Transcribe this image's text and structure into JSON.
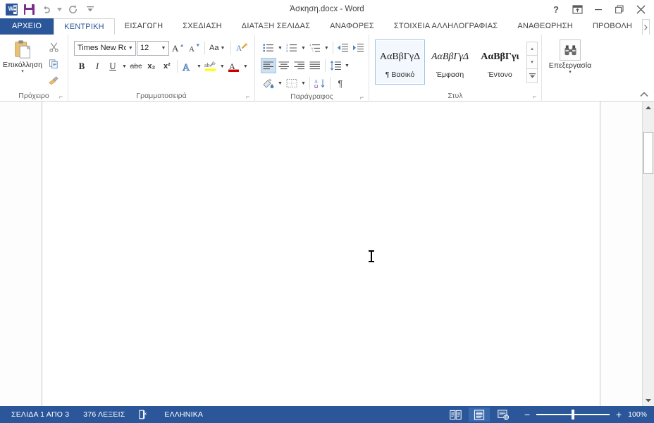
{
  "titlebar": {
    "document_title": "Άσκηση.docx - Word",
    "qat": [
      {
        "name": "word-logo",
        "label": "W"
      },
      {
        "name": "save",
        "label": "Αποθήκευση"
      },
      {
        "name": "undo",
        "label": "Αναίρεση"
      },
      {
        "name": "redo",
        "label": "Επανάληψη"
      },
      {
        "name": "customize",
        "label": "Προσαρμογή γραμμής εργαλείων γρήγορης πρόσβασης"
      }
    ],
    "window_controls": {
      "help": "?",
      "ribbon_display": "Επιλογές εμφάνισης κορδέλας",
      "minimize": "Ελαχιστοποίηση",
      "restore": "Επαναφορά",
      "close": "Κλείσιμο"
    }
  },
  "tabs": [
    {
      "label": "ΑΡΧΕΙΟ",
      "active": false,
      "file": true
    },
    {
      "label": "ΚΕΝΤΡΙΚΗ",
      "active": true,
      "file": false
    },
    {
      "label": "ΕΙΣΑΓΩΓΗ",
      "active": false,
      "file": false
    },
    {
      "label": "ΣΧΕΔΙΑΣΗ",
      "active": false,
      "file": false
    },
    {
      "label": "ΔΙΑΤΑΞΗ ΣΕΛΙΔΑΣ",
      "active": false,
      "file": false
    },
    {
      "label": "ΑΝΑΦΟΡΕΣ",
      "active": false,
      "file": false
    },
    {
      "label": "ΣΤΟΙΧΕΙΑ ΑΛΛΗΛΟΓΡΑΦΙΑΣ",
      "active": false,
      "file": false
    },
    {
      "label": "ΑΝΑΘΕΩΡΗΣΗ",
      "active": false,
      "file": false
    },
    {
      "label": "ΠΡΟΒΟΛΗ",
      "active": false,
      "file": false
    }
  ],
  "ribbon": {
    "clipboard": {
      "group_label": "Πρόχειρο",
      "paste_label": "Επικόλληση",
      "paste_caret": "▾",
      "cut_label": "Αποκοπή",
      "copy_label": "Αντιγραφή",
      "format_painter_label": "Πινέλο μορφοποίησης"
    },
    "font": {
      "group_label": "Γραμματοσειρά",
      "font_name": "Times New Ro",
      "font_size": "12",
      "grow_font": "A",
      "shrink_font": "A",
      "change_case": "Aa",
      "clear_formatting": "Απαλοιφή μορφοποίησης",
      "bold": "B",
      "italic": "I",
      "underline": "U",
      "strikethrough": "abc",
      "subscript": "x₂",
      "superscript": "x²",
      "text_effects": "A",
      "highlight": "ab",
      "font_color": "A"
    },
    "paragraph": {
      "group_label": "Παράγραφος",
      "bullets": "Κουκκίδες",
      "numbering": "Αρίθμηση",
      "multilevel": "Λίστα πολλών επιπέδων",
      "decrease_indent": "Μείωση εσοχής",
      "increase_indent": "Αύξηση εσοχής",
      "align_left": "Στοίχιση αριστερά",
      "align_center": "Στοίχιση στο κέντρο",
      "align_right": "Στοίχιση δεξιά",
      "justify": "Πλήρης στοίχιση",
      "line_spacing": "Διάστιχο",
      "shading": "Σκίαση",
      "borders": "Περιγράμματα",
      "sort": "Ταξινόμηση",
      "show_marks": "¶"
    },
    "styles": {
      "group_label": "Στυλ",
      "items": [
        {
          "preview": "ΑαΒβΓγΔ",
          "name": "¶ Βασικό",
          "style": "normal",
          "selected": true
        },
        {
          "preview": "ΑαΒβΓγΔ",
          "name": "Έμφαση",
          "style": "italic",
          "selected": false
        },
        {
          "preview": "ΑαΒβΓγι",
          "name": "Έντονο",
          "style": "bold",
          "selected": false
        }
      ],
      "scroll_up": "▴",
      "scroll_down": "▾",
      "more": "▾"
    },
    "editing": {
      "group_label": "",
      "button_label": "Επεξεργασία",
      "caret": "▾"
    },
    "collapse_label": "^"
  },
  "document": {
    "cursor": "text-cursor"
  },
  "scrollbar": {
    "up_arrow": "▲",
    "down_arrow": "▼"
  },
  "statusbar": {
    "page_info": "ΣΕΛΙΔΑ 1 ΑΠΟ 3",
    "word_count": "376 ΛΕΞΕΙΣ",
    "proofing": "Έλεγχος ορθογραφίας και γραμματικής",
    "language": "ΕΛΛΗΝΙΚΑ",
    "views": [
      {
        "name": "read-mode",
        "active": false
      },
      {
        "name": "print-layout",
        "active": true
      },
      {
        "name": "web-layout",
        "active": false
      }
    ],
    "zoom_out": "−",
    "zoom_in": "+",
    "zoom_level": "100%"
  },
  "colors": {
    "accent": "#2b579a",
    "ribbon_bg": "#ffffff",
    "status_bg": "#2b579a",
    "highlight_yellow": "#ffff00",
    "font_color_red": "#cc0000"
  }
}
